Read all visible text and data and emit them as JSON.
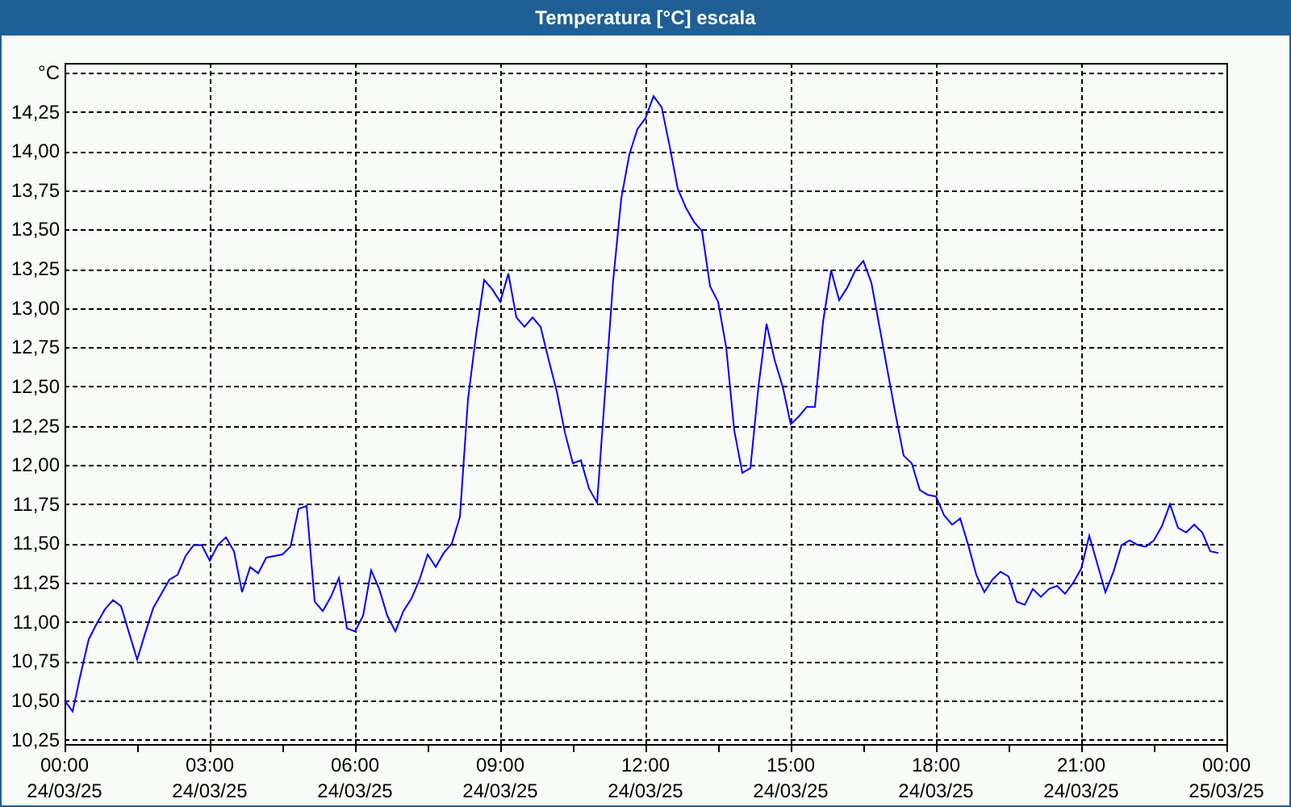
{
  "window": {
    "title": "Temperatura [°C] escala"
  },
  "chart": {
    "chart_data": {
      "type": "line",
      "grid": true,
      "ylabel": "°C",
      "ylim": [
        10.25,
        14.5
      ],
      "yticks": [
        {
          "value": 10.25,
          "label": "10,25"
        },
        {
          "value": 10.5,
          "label": "10,50"
        },
        {
          "value": 10.75,
          "label": "10,75"
        },
        {
          "value": 11,
          "label": "11,00"
        },
        {
          "value": 11.25,
          "label": "11,25"
        },
        {
          "value": 11.5,
          "label": "11,50"
        },
        {
          "value": 11.75,
          "label": "11,75"
        },
        {
          "value": 12,
          "label": "12,00"
        },
        {
          "value": 12.25,
          "label": "12,25"
        },
        {
          "value": 12.5,
          "label": "12,50"
        },
        {
          "value": 12.75,
          "label": "12,75"
        },
        {
          "value": 13,
          "label": "13,00"
        },
        {
          "value": 13.25,
          "label": "13,25"
        },
        {
          "value": 13.5,
          "label": "13,50"
        },
        {
          "value": 13.75,
          "label": "13,75"
        },
        {
          "value": 14,
          "label": "14,00"
        },
        {
          "value": 14.25,
          "label": "14,25"
        }
      ],
      "categories": [
        "00:00 24/03/25",
        null,
        null,
        null,
        null,
        null,
        null,
        null,
        null,
        null,
        null,
        null,
        null,
        null,
        null,
        null,
        null,
        null,
        "03:00 24/03/25",
        null,
        null,
        null,
        null,
        null,
        null,
        null,
        null,
        null,
        null,
        null,
        null,
        null,
        null,
        null,
        null,
        null,
        "06:00 24/03/25",
        null,
        null,
        null,
        null,
        null,
        null,
        null,
        null,
        null,
        null,
        null,
        null,
        null,
        null,
        null,
        null,
        null,
        "09:00 24/03/25",
        null,
        null,
        null,
        null,
        null,
        null,
        null,
        null,
        null,
        null,
        null,
        null,
        null,
        null,
        null,
        null,
        null,
        "12:00 24/03/25",
        null,
        null,
        null,
        null,
        null,
        null,
        null,
        null,
        null,
        null,
        null,
        null,
        null,
        null,
        null,
        null,
        null,
        "15:00 24/03/25",
        null,
        null,
        null,
        null,
        null,
        null,
        null,
        null,
        null,
        null,
        null,
        null,
        null,
        null,
        null,
        null,
        null,
        "18:00 24/03/25",
        null,
        null,
        null,
        null,
        null,
        null,
        null,
        null,
        null,
        null,
        null,
        null,
        null,
        null,
        null,
        null,
        null,
        "21:00 24/03/25",
        null,
        null,
        null,
        null,
        null,
        null,
        null,
        null,
        null,
        null,
        null,
        null,
        null,
        null,
        null,
        null,
        null,
        "00:00 25/03/25"
      ],
      "series": [
        {
          "color": "#0000ff",
          "values": [
            10.5,
            10.43,
            10.67,
            10.89,
            10.99,
            11.08,
            11.14,
            11.1,
            10.93,
            10.76,
            10.93,
            11.09,
            11.18,
            11.27,
            11.3,
            11.42,
            11.49,
            11.49,
            11.39,
            11.49,
            11.54,
            11.45,
            11.19,
            11.35,
            11.31,
            11.41,
            11.42,
            11.43,
            11.48,
            11.72,
            11.74,
            11.13,
            11.07,
            11.16,
            11.28,
            10.96,
            10.94,
            11.04,
            11.33,
            11.21,
            11.04,
            10.94,
            11.07,
            11.15,
            11.27,
            11.43,
            11.35,
            11.44,
            11.5,
            11.67,
            12.42,
            12.83,
            13.18,
            13.12,
            13.04,
            13.22,
            12.94,
            12.88,
            12.94,
            12.88,
            12.67,
            12.47,
            12.21,
            12.01,
            12.03,
            11.85,
            11.76,
            12.47,
            13.18,
            13.7,
            13.98,
            14.14,
            14.21,
            14.35,
            14.28,
            14.03,
            13.76,
            13.64,
            13.55,
            13.49,
            13.14,
            13.04,
            12.75,
            12.22,
            11.95,
            11.98,
            12.5,
            12.9,
            12.67,
            12.5,
            12.26,
            12.31,
            12.37,
            12.37,
            12.91,
            13.24,
            13.05,
            13.13,
            13.24,
            13.3,
            13.16,
            12.88,
            12.6,
            12.32,
            12.06,
            12.01,
            11.84,
            11.81,
            11.8,
            11.68,
            11.62,
            11.66,
            11.49,
            11.3,
            11.19,
            11.27,
            11.32,
            11.29,
            11.13,
            11.11,
            11.21,
            11.16,
            11.21,
            11.23,
            11.18,
            11.25,
            11.34,
            11.55,
            11.37,
            11.19,
            11.32,
            11.49,
            11.52,
            11.49,
            11.48,
            11.52,
            11.61,
            11.75,
            11.6,
            11.57,
            11.62,
            11.57,
            11.45,
            11.44,
            null
          ]
        }
      ]
    }
  }
}
